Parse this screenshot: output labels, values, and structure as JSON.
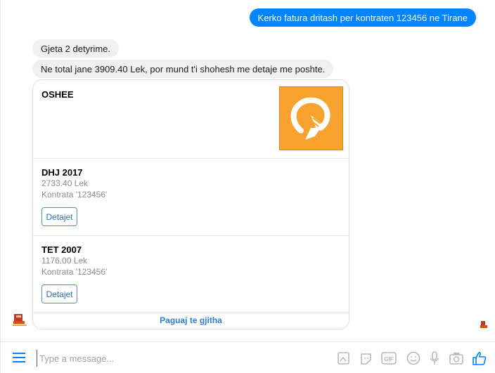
{
  "messages": {
    "user_query": "Kerko fatura dritash per kontraten 123456 ne Tirane",
    "reply_found": "Gjeta 2 detyrime.",
    "reply_total": "Ne total jane 3909.40 Lek, por mund t'i shohesh me detaje me poshte."
  },
  "card": {
    "provider": "OSHEE",
    "logo_icon": "oshee-logo-icon",
    "logo_color": "#f7a22d",
    "bills": [
      {
        "period": "DHJ 2017",
        "amount": "2733.40 Lek",
        "contract": "Kontrata '123456'",
        "button": "Detajet"
      },
      {
        "period": "TET 2007",
        "amount": "1176.00 Lek",
        "contract": "Kontrata '123456'",
        "button": "Detajet"
      }
    ],
    "pay_all": "Paguaj te gjitha"
  },
  "composer": {
    "placeholder": "Type a message...",
    "icons": [
      "menu-icon",
      "sticker-icon",
      "emoji-sticker-icon",
      "gif-icon",
      "emoji-icon",
      "microphone-icon",
      "camera-icon",
      "like-icon"
    ]
  },
  "colors": {
    "accent": "#0084ff",
    "incoming_bubble": "#f1f0f0"
  }
}
